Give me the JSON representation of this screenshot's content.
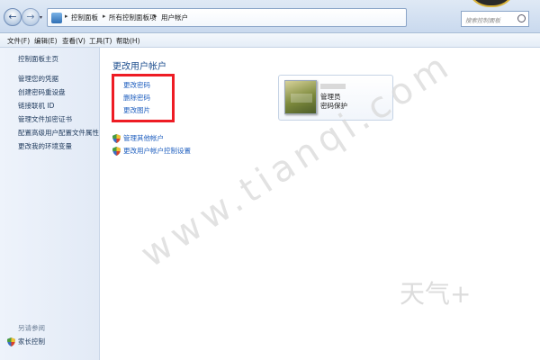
{
  "address_bar": {
    "crumbs": [
      "控制面板",
      "所有控制面板项",
      "用户帐户"
    ],
    "search_placeholder": "搜索控制面板"
  },
  "menu": {
    "items": [
      "文件(F)",
      "编辑(E)",
      "查看(V)",
      "工具(T)",
      "帮助(H)"
    ]
  },
  "sidebar": {
    "home": "控制面板主页",
    "items": [
      "管理您的凭据",
      "创建密码重设盘",
      "链接联机 ID",
      "管理文件加密证书",
      "配置高级用户配置文件属性",
      "更改我的环境变量"
    ],
    "see_also": "另请参阅",
    "parental_controls": "家长控制"
  },
  "main": {
    "title": "更改用户帐户",
    "tasks": [
      "更改密码",
      "删除密码",
      "更改图片"
    ],
    "other_links": [
      "管理其他帐户",
      "更改用户帐户控制设置"
    ],
    "user": {
      "name": "管理员",
      "role": "密码保护"
    }
  },
  "watermark": {
    "url": "www.tianqi.com",
    "brand": "天气+"
  },
  "colors": {
    "highlight": "#ee1c24",
    "link": "#1f5fbf"
  }
}
